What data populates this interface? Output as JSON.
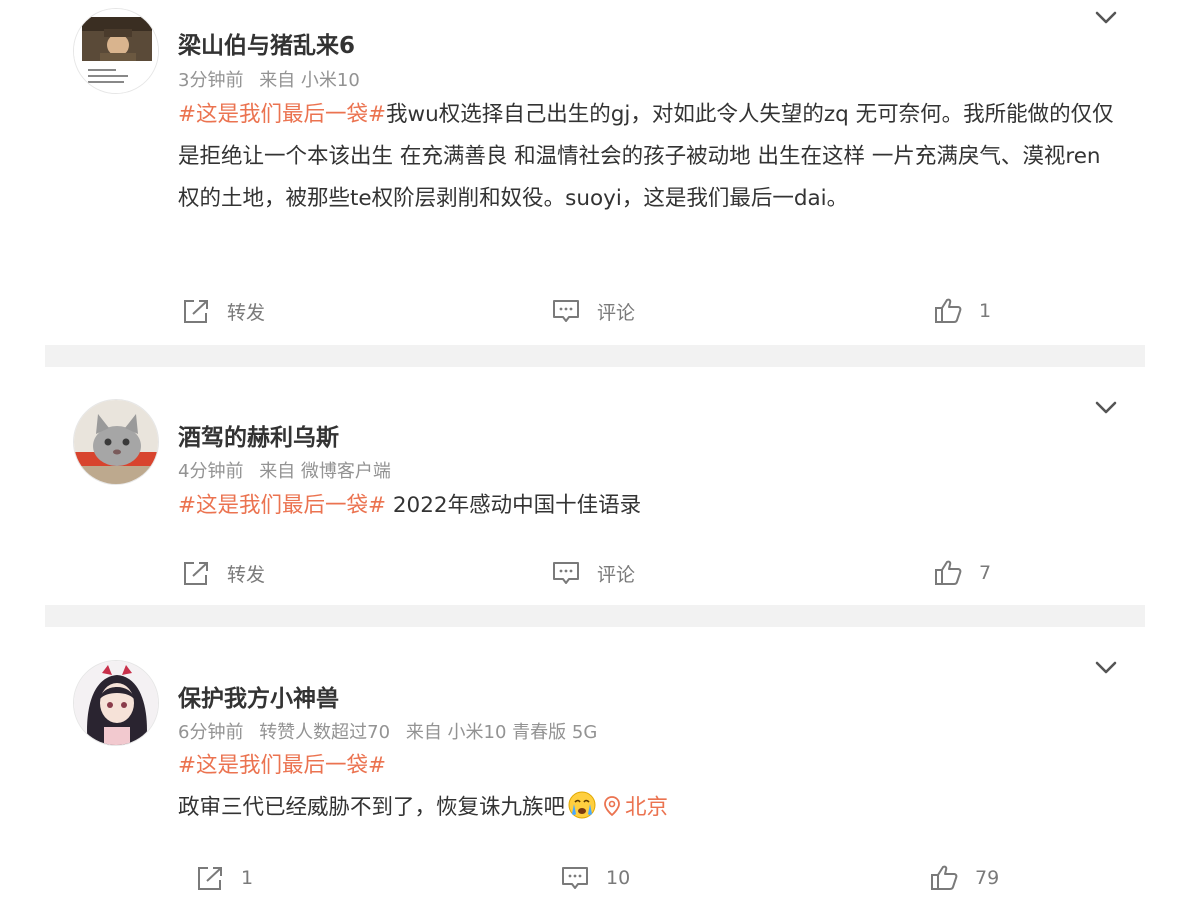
{
  "posts": [
    {
      "username": "梁山伯与猪乱来6",
      "meta": [
        "3分钟前",
        "来自 小米10"
      ],
      "hashtag": "#这是我们最后一袋#",
      "text": "我wu权选择自己出生的gj，对如此令人失望的zq 无可奈何。我所能做的仅仅 是拒绝让一个本该出生 在充满善良 和温情社会的孩子被动地 出生在这样 一片充满戾气、漠视ren 权的土地，被那些te权阶层剥削和奴役。suoyi，这是我们最后一dai。",
      "repost_label": "转发",
      "comment_label": "评论",
      "like_count": "1"
    },
    {
      "username": "酒驾的赫利乌斯",
      "meta": [
        "4分钟前",
        "来自 微博客户端"
      ],
      "hashtag": "#这是我们最后一袋#",
      "text": " 2022年感动中国十佳语录",
      "repost_label": "转发",
      "comment_label": "评论",
      "like_count": "7"
    },
    {
      "username": "保护我方小神兽",
      "meta": [
        "6分钟前",
        "转赞人数超过70",
        "来自 小米10 青春版 5G"
      ],
      "hashtag": "#这是我们最后一袋#",
      "text": "政审三代已经威胁不到了，恢复诛九族吧",
      "location": "北京",
      "repost_label": "1",
      "comment_label": "10",
      "like_count": "79"
    }
  ],
  "icons": {
    "more": "chevron-down-icon",
    "repost": "share-icon",
    "comment": "comment-icon",
    "like": "thumbs-up-icon",
    "location": "location-pin-icon",
    "emoji": "crying-face-emoji"
  },
  "colors": {
    "accent": "#eb7350",
    "meta": "#939393",
    "text": "#333333",
    "divider": "#f2f2f2"
  }
}
